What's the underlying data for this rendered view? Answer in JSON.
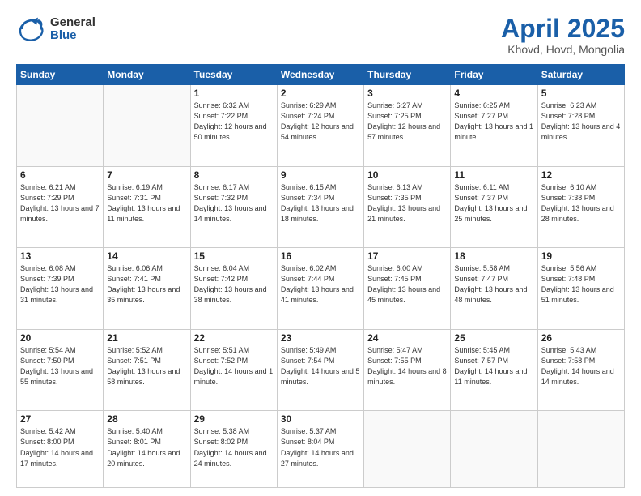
{
  "logo": {
    "general": "General",
    "blue": "Blue"
  },
  "header": {
    "title": "April 2025",
    "subtitle": "Khovd, Hovd, Mongolia"
  },
  "weekdays": [
    "Sunday",
    "Monday",
    "Tuesday",
    "Wednesday",
    "Thursday",
    "Friday",
    "Saturday"
  ],
  "weeks": [
    [
      {
        "day": "",
        "sunrise": "",
        "sunset": "",
        "daylight": ""
      },
      {
        "day": "",
        "sunrise": "",
        "sunset": "",
        "daylight": ""
      },
      {
        "day": "1",
        "sunrise": "Sunrise: 6:32 AM",
        "sunset": "Sunset: 7:22 PM",
        "daylight": "Daylight: 12 hours and 50 minutes."
      },
      {
        "day": "2",
        "sunrise": "Sunrise: 6:29 AM",
        "sunset": "Sunset: 7:24 PM",
        "daylight": "Daylight: 12 hours and 54 minutes."
      },
      {
        "day": "3",
        "sunrise": "Sunrise: 6:27 AM",
        "sunset": "Sunset: 7:25 PM",
        "daylight": "Daylight: 12 hours and 57 minutes."
      },
      {
        "day": "4",
        "sunrise": "Sunrise: 6:25 AM",
        "sunset": "Sunset: 7:27 PM",
        "daylight": "Daylight: 13 hours and 1 minute."
      },
      {
        "day": "5",
        "sunrise": "Sunrise: 6:23 AM",
        "sunset": "Sunset: 7:28 PM",
        "daylight": "Daylight: 13 hours and 4 minutes."
      }
    ],
    [
      {
        "day": "6",
        "sunrise": "Sunrise: 6:21 AM",
        "sunset": "Sunset: 7:29 PM",
        "daylight": "Daylight: 13 hours and 7 minutes."
      },
      {
        "day": "7",
        "sunrise": "Sunrise: 6:19 AM",
        "sunset": "Sunset: 7:31 PM",
        "daylight": "Daylight: 13 hours and 11 minutes."
      },
      {
        "day": "8",
        "sunrise": "Sunrise: 6:17 AM",
        "sunset": "Sunset: 7:32 PM",
        "daylight": "Daylight: 13 hours and 14 minutes."
      },
      {
        "day": "9",
        "sunrise": "Sunrise: 6:15 AM",
        "sunset": "Sunset: 7:34 PM",
        "daylight": "Daylight: 13 hours and 18 minutes."
      },
      {
        "day": "10",
        "sunrise": "Sunrise: 6:13 AM",
        "sunset": "Sunset: 7:35 PM",
        "daylight": "Daylight: 13 hours and 21 minutes."
      },
      {
        "day": "11",
        "sunrise": "Sunrise: 6:11 AM",
        "sunset": "Sunset: 7:37 PM",
        "daylight": "Daylight: 13 hours and 25 minutes."
      },
      {
        "day": "12",
        "sunrise": "Sunrise: 6:10 AM",
        "sunset": "Sunset: 7:38 PM",
        "daylight": "Daylight: 13 hours and 28 minutes."
      }
    ],
    [
      {
        "day": "13",
        "sunrise": "Sunrise: 6:08 AM",
        "sunset": "Sunset: 7:39 PM",
        "daylight": "Daylight: 13 hours and 31 minutes."
      },
      {
        "day": "14",
        "sunrise": "Sunrise: 6:06 AM",
        "sunset": "Sunset: 7:41 PM",
        "daylight": "Daylight: 13 hours and 35 minutes."
      },
      {
        "day": "15",
        "sunrise": "Sunrise: 6:04 AM",
        "sunset": "Sunset: 7:42 PM",
        "daylight": "Daylight: 13 hours and 38 minutes."
      },
      {
        "day": "16",
        "sunrise": "Sunrise: 6:02 AM",
        "sunset": "Sunset: 7:44 PM",
        "daylight": "Daylight: 13 hours and 41 minutes."
      },
      {
        "day": "17",
        "sunrise": "Sunrise: 6:00 AM",
        "sunset": "Sunset: 7:45 PM",
        "daylight": "Daylight: 13 hours and 45 minutes."
      },
      {
        "day": "18",
        "sunrise": "Sunrise: 5:58 AM",
        "sunset": "Sunset: 7:47 PM",
        "daylight": "Daylight: 13 hours and 48 minutes."
      },
      {
        "day": "19",
        "sunrise": "Sunrise: 5:56 AM",
        "sunset": "Sunset: 7:48 PM",
        "daylight": "Daylight: 13 hours and 51 minutes."
      }
    ],
    [
      {
        "day": "20",
        "sunrise": "Sunrise: 5:54 AM",
        "sunset": "Sunset: 7:50 PM",
        "daylight": "Daylight: 13 hours and 55 minutes."
      },
      {
        "day": "21",
        "sunrise": "Sunrise: 5:52 AM",
        "sunset": "Sunset: 7:51 PM",
        "daylight": "Daylight: 13 hours and 58 minutes."
      },
      {
        "day": "22",
        "sunrise": "Sunrise: 5:51 AM",
        "sunset": "Sunset: 7:52 PM",
        "daylight": "Daylight: 14 hours and 1 minute."
      },
      {
        "day": "23",
        "sunrise": "Sunrise: 5:49 AM",
        "sunset": "Sunset: 7:54 PM",
        "daylight": "Daylight: 14 hours and 5 minutes."
      },
      {
        "day": "24",
        "sunrise": "Sunrise: 5:47 AM",
        "sunset": "Sunset: 7:55 PM",
        "daylight": "Daylight: 14 hours and 8 minutes."
      },
      {
        "day": "25",
        "sunrise": "Sunrise: 5:45 AM",
        "sunset": "Sunset: 7:57 PM",
        "daylight": "Daylight: 14 hours and 11 minutes."
      },
      {
        "day": "26",
        "sunrise": "Sunrise: 5:43 AM",
        "sunset": "Sunset: 7:58 PM",
        "daylight": "Daylight: 14 hours and 14 minutes."
      }
    ],
    [
      {
        "day": "27",
        "sunrise": "Sunrise: 5:42 AM",
        "sunset": "Sunset: 8:00 PM",
        "daylight": "Daylight: 14 hours and 17 minutes."
      },
      {
        "day": "28",
        "sunrise": "Sunrise: 5:40 AM",
        "sunset": "Sunset: 8:01 PM",
        "daylight": "Daylight: 14 hours and 20 minutes."
      },
      {
        "day": "29",
        "sunrise": "Sunrise: 5:38 AM",
        "sunset": "Sunset: 8:02 PM",
        "daylight": "Daylight: 14 hours and 24 minutes."
      },
      {
        "day": "30",
        "sunrise": "Sunrise: 5:37 AM",
        "sunset": "Sunset: 8:04 PM",
        "daylight": "Daylight: 14 hours and 27 minutes."
      },
      {
        "day": "",
        "sunrise": "",
        "sunset": "",
        "daylight": ""
      },
      {
        "day": "",
        "sunrise": "",
        "sunset": "",
        "daylight": ""
      },
      {
        "day": "",
        "sunrise": "",
        "sunset": "",
        "daylight": ""
      }
    ]
  ]
}
